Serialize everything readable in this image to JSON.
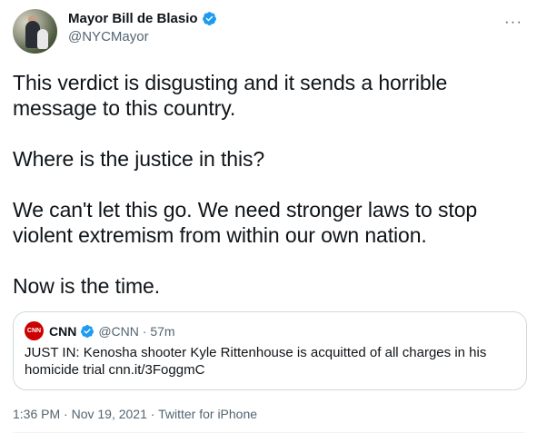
{
  "author": {
    "display_name": "Mayor Bill de Blasio",
    "handle": "@NYCMayor",
    "verified_icon": "verified-badge-icon",
    "verified_color": "#1d9bf0"
  },
  "menu_icon": "···",
  "tweet_text": "This verdict is disgusting and it sends a horrible\nmessage to this country.\n\nWhere is the justice in this?\n\nWe can't let this go. We need stronger laws to stop\nviolent extremism from within our own nation.\n\nNow is the time.",
  "quote": {
    "logo_text": "CNN",
    "name": "CNN",
    "handle_time": "@CNN · 57m",
    "text": "JUST IN: Kenosha shooter Kyle Rittenhouse is acquitted of all charges in his\nhomicide trial cnn.it/3FoggmC",
    "logo_color": "#cc0000"
  },
  "meta": {
    "time": "1:36 PM",
    "sep1": " · ",
    "date": "Nov 19, 2021",
    "sep2": " · ",
    "source": "Twitter for iPhone"
  }
}
